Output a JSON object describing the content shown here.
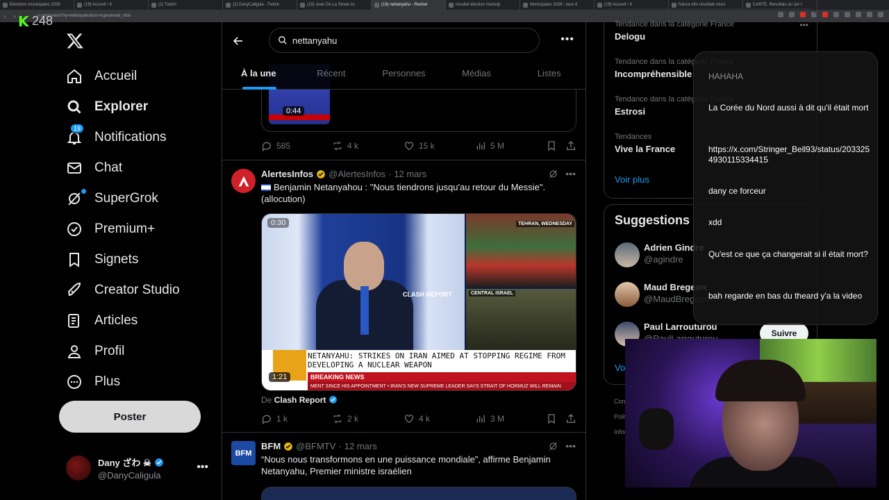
{
  "browser": {
    "tabs": [
      {
        "label": "Elections municipales 2026"
      },
      {
        "label": "(18) Accueil / X"
      },
      {
        "label": "(2) Twitch"
      },
      {
        "label": "(2) DanyCaligula - Twitch"
      },
      {
        "label": "(19) Jean De La Street su"
      },
      {
        "label": "(19) nettanyahu - Recher",
        "active": true
      },
      {
        "label": "résultat élection municip"
      },
      {
        "label": "Municipales 2026 : taux d"
      },
      {
        "label": "(19) Accueil / X"
      },
      {
        "label": "france info résultats muni"
      },
      {
        "label": "CARTE. Résultats du 1er t"
      }
    ],
    "url": "x.com/search?q=nettanyahu&src=typeahead_click"
  },
  "overlay_logo": {
    "number": "248"
  },
  "nav": {
    "items": [
      {
        "label": "Accueil",
        "icon": "home-icon"
      },
      {
        "label": "Explorer",
        "icon": "search-icon",
        "bold": true
      },
      {
        "label": "Notifications",
        "icon": "bell-icon",
        "badge": "19"
      },
      {
        "label": "Chat",
        "icon": "mail-icon"
      },
      {
        "label": "SuperGrok",
        "icon": "grok-icon"
      },
      {
        "label": "Premium+",
        "icon": "verified-icon"
      },
      {
        "label": "Signets",
        "icon": "bookmark-icon"
      },
      {
        "label": "Creator Studio",
        "icon": "rocket-icon"
      },
      {
        "label": "Articles",
        "icon": "article-icon"
      },
      {
        "label": "Profil",
        "icon": "person-icon"
      },
      {
        "label": "Plus",
        "icon": "more-circle-icon"
      }
    ],
    "post_button": "Poster",
    "account": {
      "name": "Dany ざわ ☠",
      "handle": "@DanyCaligula"
    }
  },
  "search": {
    "query": "nettanyahu",
    "tabs": [
      "À la une",
      "Récent",
      "Personnes",
      "Médias",
      "Listes"
    ],
    "active_tab": "À la une"
  },
  "tweets": {
    "first": {
      "video_duration": "0:44",
      "stats": {
        "replies": "585",
        "reposts": "4 k",
        "likes": "15 k",
        "views": "5 M"
      }
    },
    "alertes": {
      "name": "AlertesInfos",
      "handle": "@AlertesInfos",
      "date": "12 mars",
      "text": "Benjamin Netanyahou : \"Nous tiendrons jusqu'au retour du Messie\". (allocution)",
      "video": {
        "label_top": "TEHRAN, WEDNESDAY",
        "label_mid": "CENTRAL ISRAEL",
        "headline": "NETANYAHU: STRIKES ON IRAN AIMED AT STOPPING REGIME FROM DEVELOPING A NUCLEAR WEAPON",
        "breaking": "BREAKING NEWS",
        "ticker": "MENT SINCE HIS APPOINTMENT  •  IRAN'S NEW SUPREME LEADER SAYS STRAIT OF HORMUZ WILL REMAIN",
        "watermark": "CLASH REPORT",
        "duration": "1:21",
        "corner_time": "0:30"
      },
      "from_label": "De",
      "from_name": "Clash Report",
      "stats": {
        "replies": "1 k",
        "reposts": "2 k",
        "likes": "4 k",
        "views": "3 M"
      }
    },
    "bfm": {
      "name": "BFM",
      "avatar_text": "BFM",
      "handle": "@BFMTV",
      "date": "12 mars",
      "text": "“Nous nous transformons en une puissance mondiale”, affirme Benjamin Netanyahu, Premier ministre israélien"
    }
  },
  "trends": [
    {
      "category": "Tendance dans la catégorie France",
      "title": "Delogu"
    },
    {
      "category": "Tendance dans la catégorie France",
      "title": "Incompréhensible"
    },
    {
      "category": "Tendance dans la catégorie France",
      "title": "Estrosi"
    },
    {
      "category": "Tendances",
      "title": "Vive la France"
    }
  ],
  "trends_more": "Voir plus",
  "suggestions": {
    "title": "Suggestions",
    "items": [
      {
        "name": "Adrien Gindre",
        "handle": "@agindre"
      },
      {
        "name": "Maud Bregeon",
        "handle": "@MaudBregeon"
      },
      {
        "name": "Paul Larrouturou",
        "handle": "@PaulLarrouturou"
      }
    ],
    "follow_label": "Suivre",
    "more": "Voir plus"
  },
  "footer": [
    "Conditions",
    "Politique",
    "Informations"
  ],
  "chat": {
    "messages": [
      {
        "text": "HAHAHA",
        "faint": true
      },
      {
        "text": "La Corée du Nord aussi à dit qu'il était mort"
      },
      {
        "text": "https://x.com/Stringer_Bell93/status/2033254930115334415"
      },
      {
        "text": "dany ce forceur"
      },
      {
        "text": "xdd"
      },
      {
        "text": "Qu'est ce que ça changerait si il était mort?"
      },
      {
        "text": "bah regarde en bas du theard y'a la video"
      }
    ]
  },
  "colors": {
    "accent": "#1d9bf0",
    "bg": "#000000",
    "border": "#2f3336",
    "muted": "#71767b"
  }
}
